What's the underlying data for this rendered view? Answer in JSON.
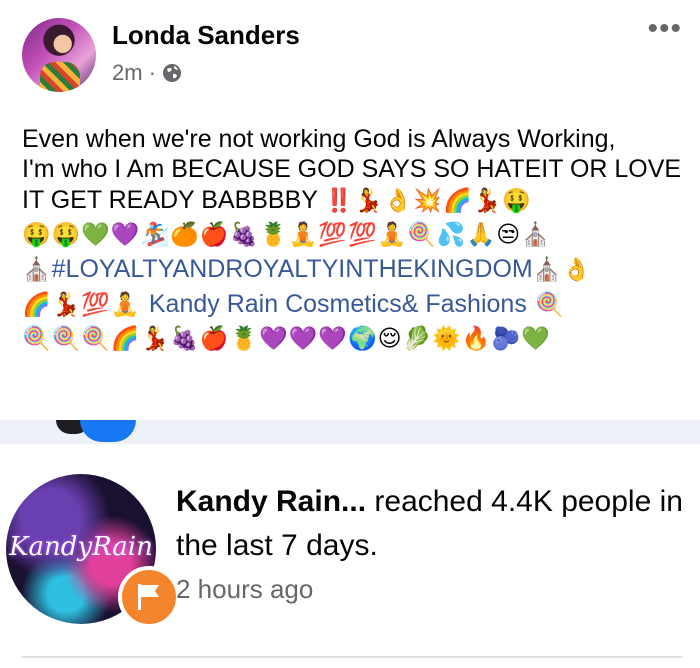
{
  "post": {
    "author": "Londa Sanders",
    "time": "2m",
    "separator": "·",
    "more": "•••",
    "line1": "Even when we're not working God is Always Working,",
    "line2": "I'm who I Am BECAUSE GOD SAYS SO HATEIT OR LOVE IT GET READY BABBBBY",
    "emoji_a": "‼️💃👌💥🌈💃🤑",
    "emoji_b": "🤑🤑💚💜🏂🍊🍎🍇🍍🧘💯💯🧘🍭💦🙏😒⛪",
    "hashtag_prefix": "⛪",
    "hashtag": "#LOYALTYANDROYALTYINTHEKINGDOM",
    "hashtag_suffix": "⛪👌",
    "emoji_c": "🌈💃💯🧘",
    "page_link": "Kandy Rain Cosmetics& Fashions",
    "emoji_c_end": "🍭",
    "emoji_d": "🍭🍭🍭🌈💃🍇🍎🍍💜💜💜🌍😌🥬🌞🔥🫐💚"
  },
  "notification": {
    "name": "Kandy Rain...",
    "text": "reached 4.4K people in the last 7 days.",
    "time": "2 hours ago",
    "avatar_text": "KandyRain",
    "badge_color": "#f5852c"
  },
  "colors": {
    "link": "#385898",
    "secondary": "#65676b",
    "accent": "#1877f2"
  }
}
